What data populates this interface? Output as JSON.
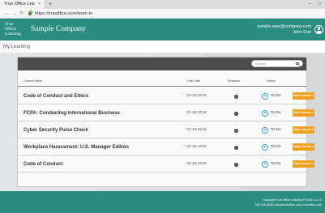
{
  "browser": {
    "tab_title": "True Office Lea",
    "tab_close": "×",
    "new_tab": "+",
    "minimize": "–",
    "maximize": "□",
    "back": "←",
    "forward": "→",
    "reload": "↻",
    "url": "https://trueoffice.com/learn-to"
  },
  "header": {
    "logo_line1": "True",
    "logo_line2": "Office",
    "logo_line3": "Learning",
    "company": "Sample Company",
    "user_email": "sample.user@company.com",
    "user_name": "John Doe"
  },
  "page": {
    "title": "My Learning"
  },
  "search": {
    "placeholder": "Search"
  },
  "table": {
    "columns": {
      "name": "Course Name",
      "due": "Due Date",
      "required": "Required",
      "status": "Status"
    },
    "rows": [
      {
        "name": "Code of Conduct and Ethics",
        "due": "03-19-2018",
        "status": "To Do",
        "action": "Start Course >"
      },
      {
        "name": "FCPA: Conducting International Business",
        "due": "03-19-2018",
        "status": "To Do",
        "action": "Start Course >"
      },
      {
        "name": "Cyber Security Pulse Check",
        "due": "03-19-2018",
        "status": "To Do",
        "action": "Start Course >"
      },
      {
        "name": "Workplace Harassment: U.S. Manager Edition",
        "due": "03-19-2018",
        "status": "To Do",
        "action": "Start Course >"
      },
      {
        "name": "Code of Conduct",
        "due": "03-19-2018",
        "status": "To Do",
        "action": "Start Course >"
      }
    ]
  },
  "footer": {
    "line1": "Copyright True Office Learning ® 2018 v.1.1.2",
    "line2": "855.326.8686 | info@trueoffice.com | trueoffice.com"
  },
  "colors": {
    "brand_teal": "#2a8d80",
    "action_orange": "#f0a020",
    "status_blue": "#2d9fd8",
    "card_header_dark": "#4c4c4c"
  },
  "icons": {
    "tab_close": "close-icon",
    "back": "arrow-left-icon",
    "forward": "arrow-right-icon",
    "reload": "reload-icon",
    "lock": "lock-icon",
    "avatar": "user-avatar-icon",
    "search": "search-icon",
    "required": "required-dot-icon",
    "status": "play-circle-icon"
  }
}
